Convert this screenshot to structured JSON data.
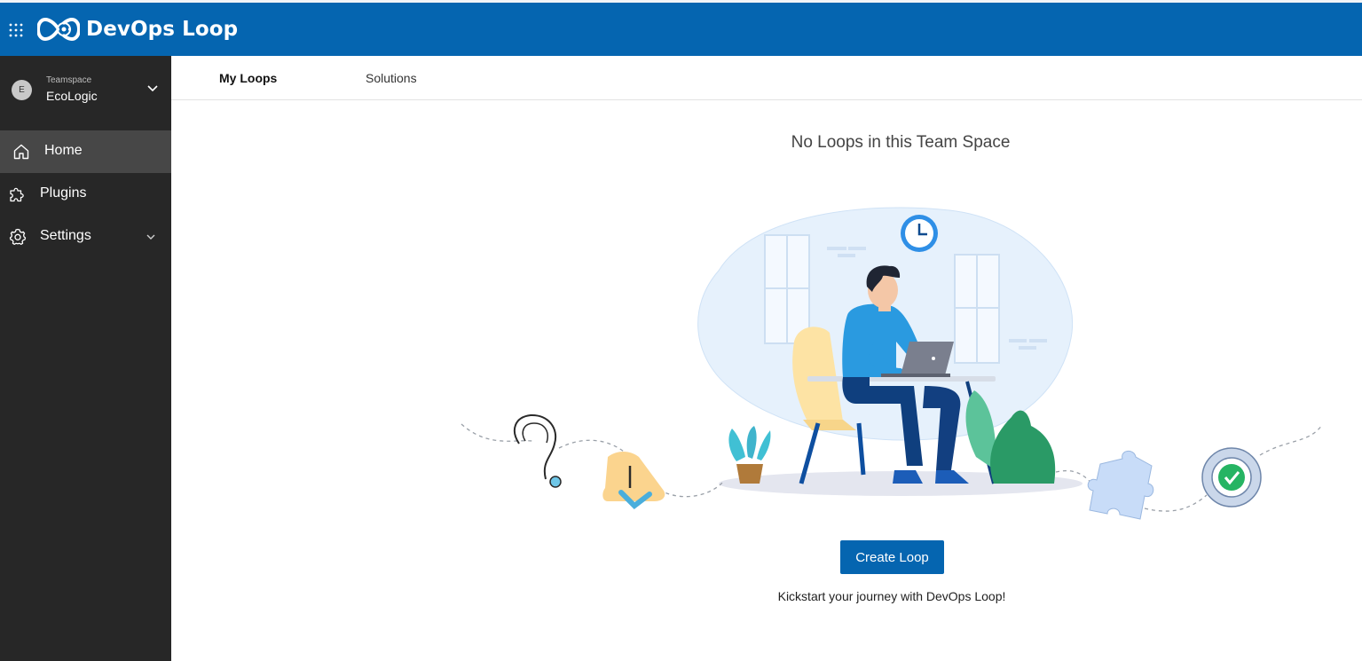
{
  "app": {
    "name": "DevOps Loop",
    "brand_color": "#0565b0"
  },
  "sidebar": {
    "teamspace_label": "Teamspace",
    "teamspace_name": "EcoLogic",
    "teamspace_initial": "E",
    "items": [
      {
        "label": "Home",
        "icon": "home-icon",
        "active": true
      },
      {
        "label": "Plugins",
        "icon": "puzzle-icon",
        "active": false
      },
      {
        "label": "Settings",
        "icon": "gear-icon",
        "active": false,
        "expandable": true
      }
    ]
  },
  "tabs": [
    {
      "label": "My Loops",
      "active": true
    },
    {
      "label": "Solutions",
      "active": false
    }
  ],
  "main": {
    "empty_title": "No Loops in this Team Space",
    "create_button": "Create Loop",
    "subtitle": "Kickstart your journey with DevOps Loop!"
  }
}
